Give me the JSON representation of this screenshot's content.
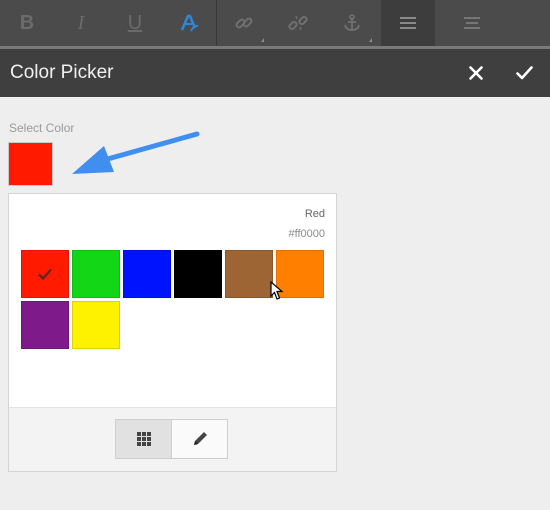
{
  "toolbar": {
    "buttons": [
      {
        "name": "bold",
        "icon": "bold-icon",
        "glyph": "B"
      },
      {
        "name": "italic",
        "icon": "italic-icon",
        "glyph": "I"
      },
      {
        "name": "underline",
        "icon": "underline-icon",
        "glyph": "U"
      },
      {
        "name": "text-color",
        "icon": "text-color-icon",
        "glyph": "A"
      },
      {
        "name": "link",
        "icon": "link-icon"
      },
      {
        "name": "unlink",
        "icon": "unlink-icon"
      },
      {
        "name": "anchor",
        "icon": "anchor-icon"
      },
      {
        "name": "align-left",
        "icon": "align-left-icon"
      },
      {
        "name": "align-center",
        "icon": "align-center-icon"
      }
    ]
  },
  "dialog": {
    "title": "Color Picker",
    "close_icon": "close-icon",
    "confirm_icon": "check-icon"
  },
  "select_label": "Select Color",
  "selected_color": "#ff1a00",
  "picker": {
    "color_name": "Red",
    "color_hex": "#ff0000",
    "swatches": [
      {
        "color": "#ff1a00",
        "selected": true
      },
      {
        "color": "#12d616",
        "selected": false
      },
      {
        "color": "#0013ff",
        "selected": false
      },
      {
        "color": "#000000",
        "selected": false
      },
      {
        "color": "#9c6533",
        "selected": false
      },
      {
        "color": "#ff8000",
        "selected": false
      },
      {
        "color": "#7f1a8a",
        "selected": false
      },
      {
        "color": "#fff200",
        "selected": false
      }
    ],
    "modes": [
      {
        "name": "swatches-mode",
        "icon": "grid-icon",
        "active": true
      },
      {
        "name": "edit-mode",
        "icon": "pencil-icon",
        "active": false
      }
    ]
  },
  "colors": {
    "accent": "#2f87d9",
    "arrow": "#3f8ef0",
    "header_bg": "#3f3f3f",
    "toolbar_bg": "#4b4b4b"
  }
}
